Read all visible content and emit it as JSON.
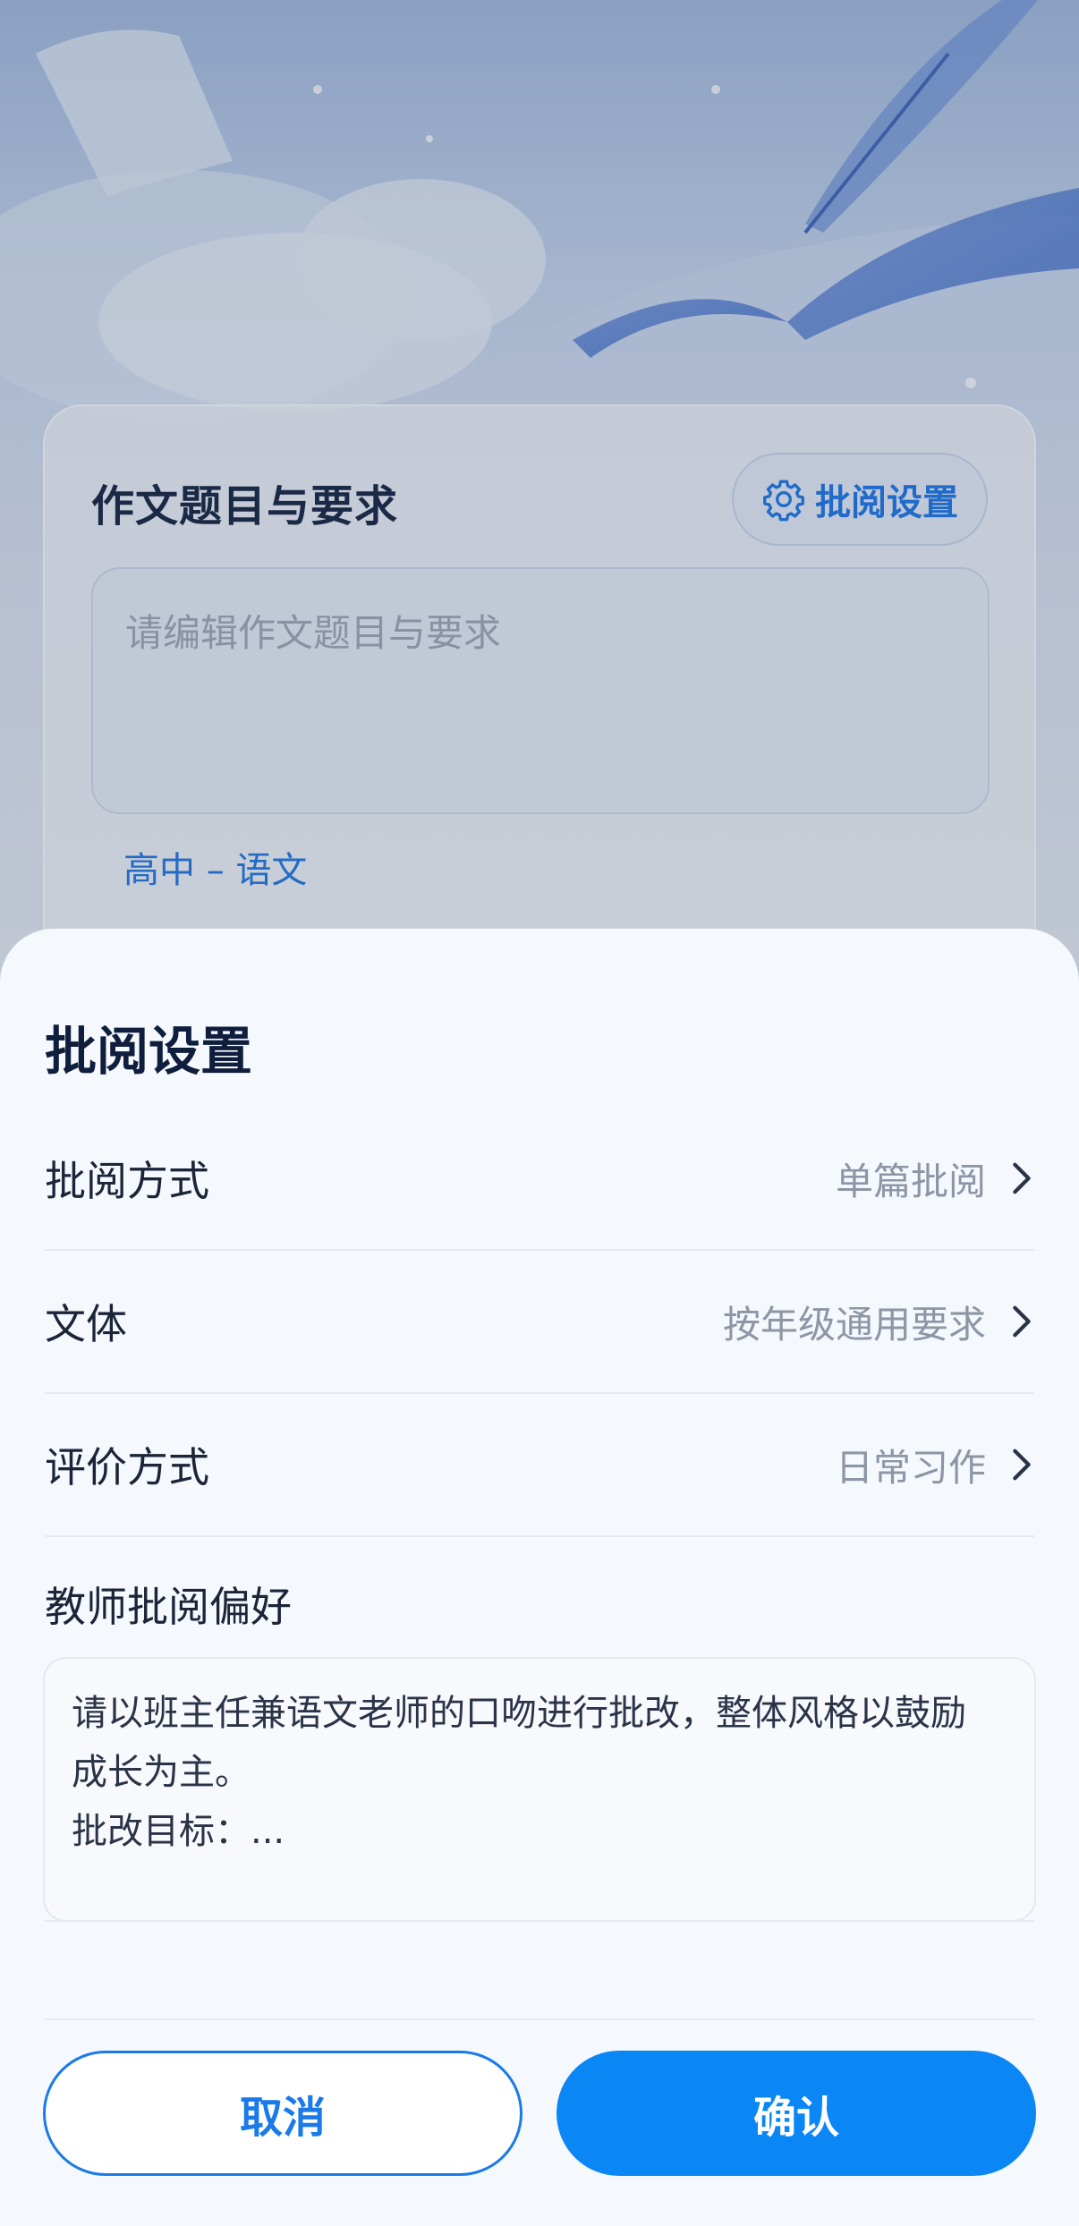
{
  "card": {
    "title": "作文题目与要求",
    "settings_button": "批阅设置",
    "topic_placeholder": "请编辑作文题目与要求",
    "grade_subject": "高中 – 语文"
  },
  "sheet": {
    "title": "批阅设置",
    "rows": [
      {
        "label": "批阅方式",
        "value": "单篇批阅"
      },
      {
        "label": "文体",
        "value": "按年级通用要求"
      },
      {
        "label": "评价方式",
        "value": "日常习作"
      }
    ],
    "preference": {
      "label": "教师批阅偏好",
      "text": "请以班主任兼语文老师的口吻进行批改，整体风格以鼓励\n成长为主。\n批改目标：..."
    },
    "cancel_label": "取消",
    "confirm_label": "确认"
  },
  "colors": {
    "accent": "#0b86f5",
    "link": "#1a73e0",
    "title": "#0f1e3d"
  },
  "icons": [
    "gear-icon",
    "chevron-right-icon"
  ]
}
